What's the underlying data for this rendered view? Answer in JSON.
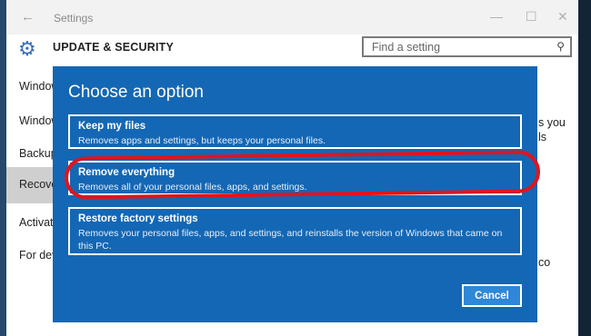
{
  "window": {
    "title": "Settings",
    "controls": {
      "back": "←",
      "minimize": "—",
      "maximize": "☐",
      "close": "✕"
    }
  },
  "header": {
    "section_title": "UPDATE & SECURITY",
    "search_placeholder": "Find a setting",
    "icons": [
      "gear-icon",
      "search-icon"
    ]
  },
  "sidebar": {
    "items": [
      {
        "label": "Windows Update"
      },
      {
        "label": "Windows Defender"
      },
      {
        "label": "Backup"
      },
      {
        "label": "Recovery",
        "selected": true
      },
      {
        "label": "Activation"
      },
      {
        "label": "For developers"
      }
    ]
  },
  "background_fragments": {
    "frag_1": "s you",
    "frag_2": "ls",
    "frag_3": "co"
  },
  "dialog": {
    "title": "Choose an option",
    "options": [
      {
        "title": "Keep my files",
        "description": "Removes apps and settings, but keeps your personal files."
      },
      {
        "title": "Remove everything",
        "description": "Removes all of your personal files, apps, and settings.",
        "highlighted": true
      },
      {
        "title": "Restore factory settings",
        "description": "Removes your personal files, apps, and settings, and reinstalls the version of Windows that came on this PC."
      }
    ],
    "cancel_label": "Cancel"
  },
  "colors": {
    "dialog_bg": "#1467b4",
    "highlight_ring": "#e0141e",
    "accent": "#3b6fb6",
    "button_bg": "#2f87d7"
  }
}
